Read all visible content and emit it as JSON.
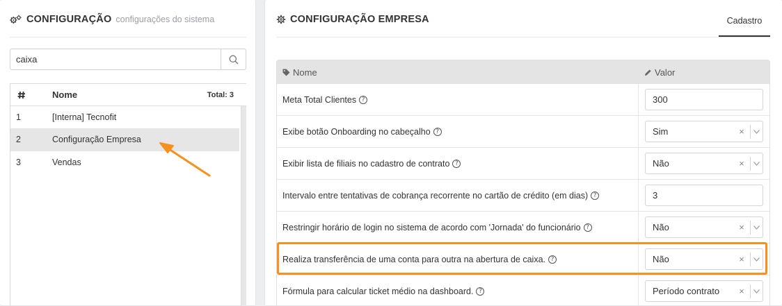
{
  "left": {
    "title": "CONFIGURAÇÃO",
    "subtitle": "configurações do sistema",
    "search": {
      "value": "caixa"
    },
    "list": {
      "header_icon": "hash-icon",
      "col_name": "Nome",
      "total": "Total: 3",
      "rows": [
        {
          "idx": "1",
          "name": "[Interna] Tecnofit"
        },
        {
          "idx": "2",
          "name": "Configuração Empresa"
        },
        {
          "idx": "3",
          "name": "Vendas"
        }
      ]
    }
  },
  "right": {
    "title": "CONFIGURAÇÃO EMPRESA",
    "tab": "Cadastro",
    "table": {
      "col_name": "Nome",
      "col_value": "Valor",
      "rows": [
        {
          "label": "Meta Total Clientes",
          "type": "input",
          "value": "300"
        },
        {
          "label": "Exibe botão Onboarding no cabeçalho",
          "type": "select",
          "value": "Sim"
        },
        {
          "label": "Exibir lista de filiais no cadastro de contrato",
          "type": "select",
          "value": "Não"
        },
        {
          "label": "Intervalo entre tentativas de cobrança recorrente no cartão de crédito (em dias)",
          "type": "input",
          "value": "3"
        },
        {
          "label": "Restringir horário de login no sistema de acordo com 'Jornada' do funcionário",
          "type": "select",
          "value": "Não"
        },
        {
          "label": "Realiza transferência de uma conta para outra na abertura de caixa.",
          "type": "select",
          "value": "Não"
        },
        {
          "label": "Fórmula para calcular ticket médio na dashboard.",
          "type": "select",
          "value": "Período contrato"
        }
      ]
    }
  },
  "help_glyph": "?",
  "clear_glyph": "×",
  "colors": {
    "highlight": "#f7901e",
    "selected_row": "#e6e6e6",
    "header_bg": "#e4e4e4"
  }
}
